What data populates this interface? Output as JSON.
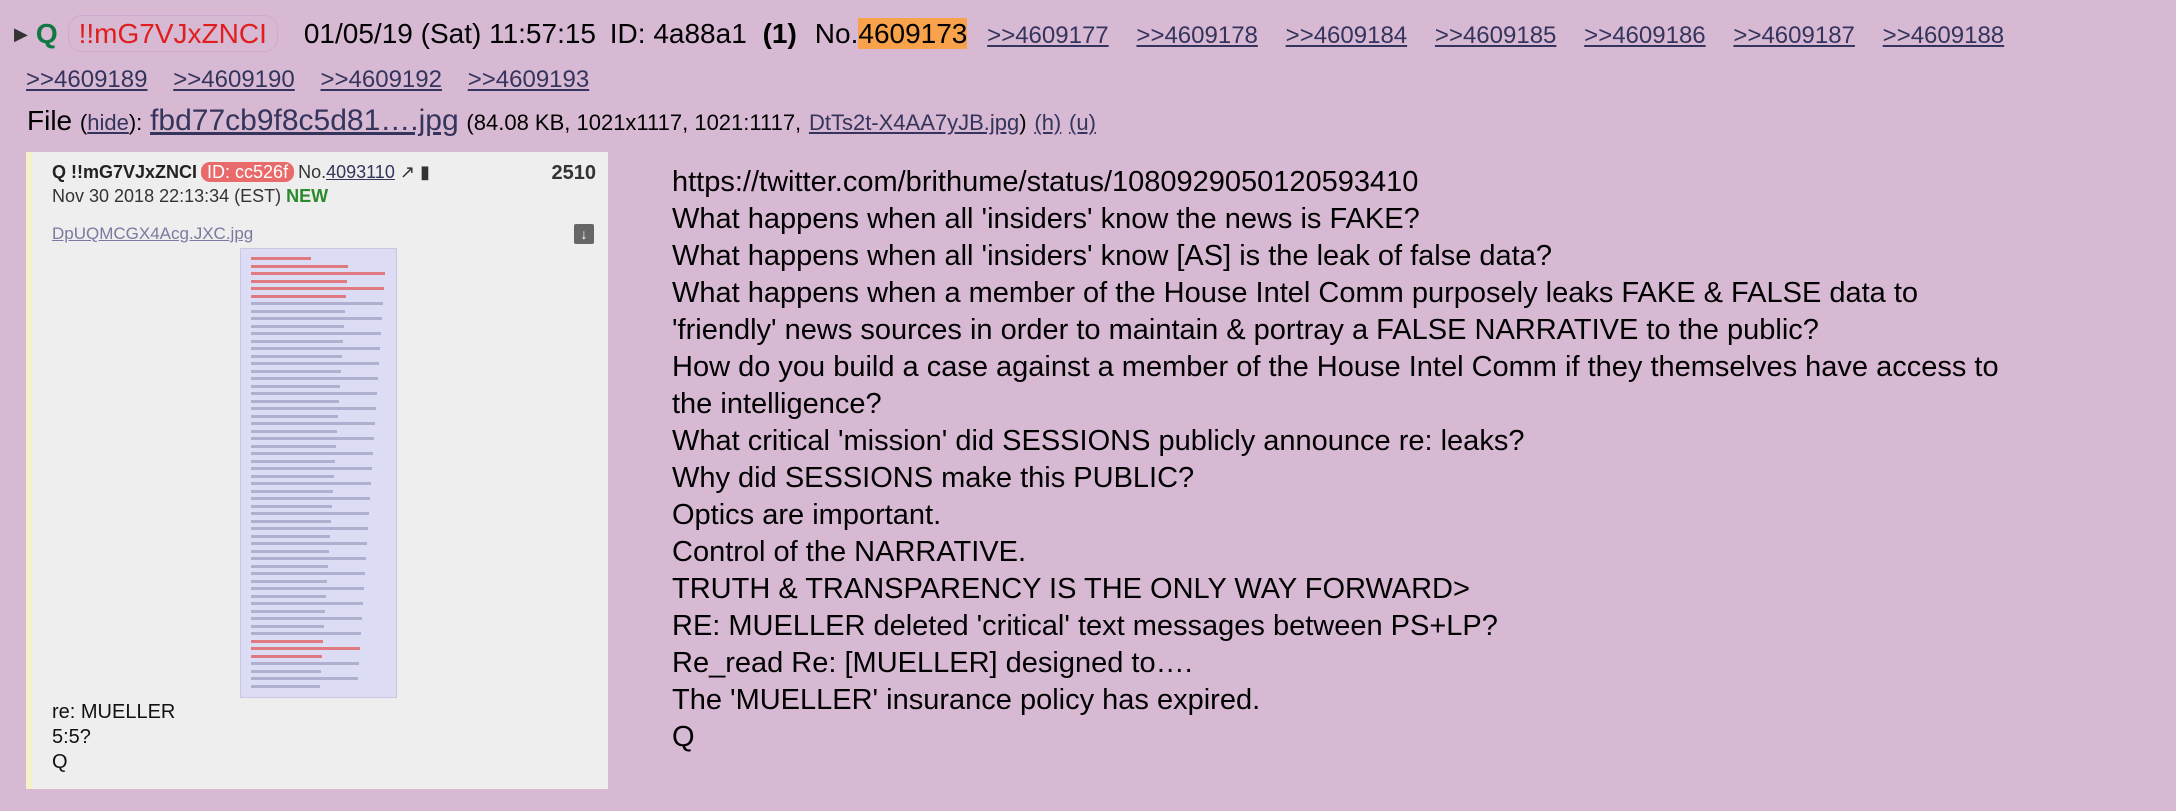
{
  "post": {
    "name": "Q",
    "tripcode": "!!mG7VJxZNCI",
    "datetime": "01/05/19 (Sat) 11:57:15",
    "id": "ID: 4a88a1",
    "count": "(1)",
    "no_label": "No.",
    "number": "4609173",
    "backlinks": [
      ">>4609177",
      ">>4609178",
      ">>4609184",
      ">>4609185",
      ">>4609186",
      ">>4609187",
      ">>4609188",
      ">>4609189",
      ">>4609190",
      ">>4609192",
      ">>4609193"
    ]
  },
  "file": {
    "label": "File",
    "hide": "hide",
    "name": "fbd77cb9f8c5d81….jpg",
    "size_info": "(84.08 KB, 1021x1117, 1021:1117,",
    "orig_name": "DtTs2t-X4AA7yJB.jpg",
    "close_paren": ")",
    "h_link": "(h)",
    "u_link": "(u)"
  },
  "thumbnail": {
    "header_q": "Q !!mG7VJxZNCI",
    "id_badge": "ID: cc526f",
    "no_label": "No.",
    "no_link": "4093110",
    "count": "2510",
    "date": "Nov 30 2018 22:13:34 (EST)",
    "new_label": "NEW",
    "file_name": "DpUQMCGX4Acg.JXC.jpg",
    "caption": "re: MUELLER\n5:5?\nQ"
  },
  "message": {
    "lines": [
      "https://twitter.com/brithume/status/1080929050120593410",
      "What happens when all 'insiders' know the news is FAKE?",
      "What happens when all 'insiders' know [AS] is the leak of false data?",
      "What happens when a member of the House Intel Comm purposely leaks FAKE & FALSE data to",
      "'friendly' news sources in order to maintain & portray a FALSE NARRATIVE to the public?",
      "How do you build a case against a member of the House Intel Comm if they themselves have access to",
      "the intelligence?",
      "What critical 'mission' did SESSIONS publicly announce re: leaks?",
      "Why did SESSIONS make this PUBLIC?",
      "Optics are important.",
      "Control of the NARRATIVE.",
      "TRUTH & TRANSPARENCY IS THE ONLY WAY FORWARD>",
      "RE: MUELLER deleted 'critical' text messages between PS+LP?",
      "Re_read Re: [MUELLER] designed to….",
      "The 'MUELLER' insurance policy has expired.",
      "Q"
    ]
  },
  "colors": {
    "background": "#d7b9d3",
    "name": "#117743",
    "tripcode": "#e01e1e",
    "post_number_highlight": "#f8a24b",
    "link": "#34345c"
  }
}
